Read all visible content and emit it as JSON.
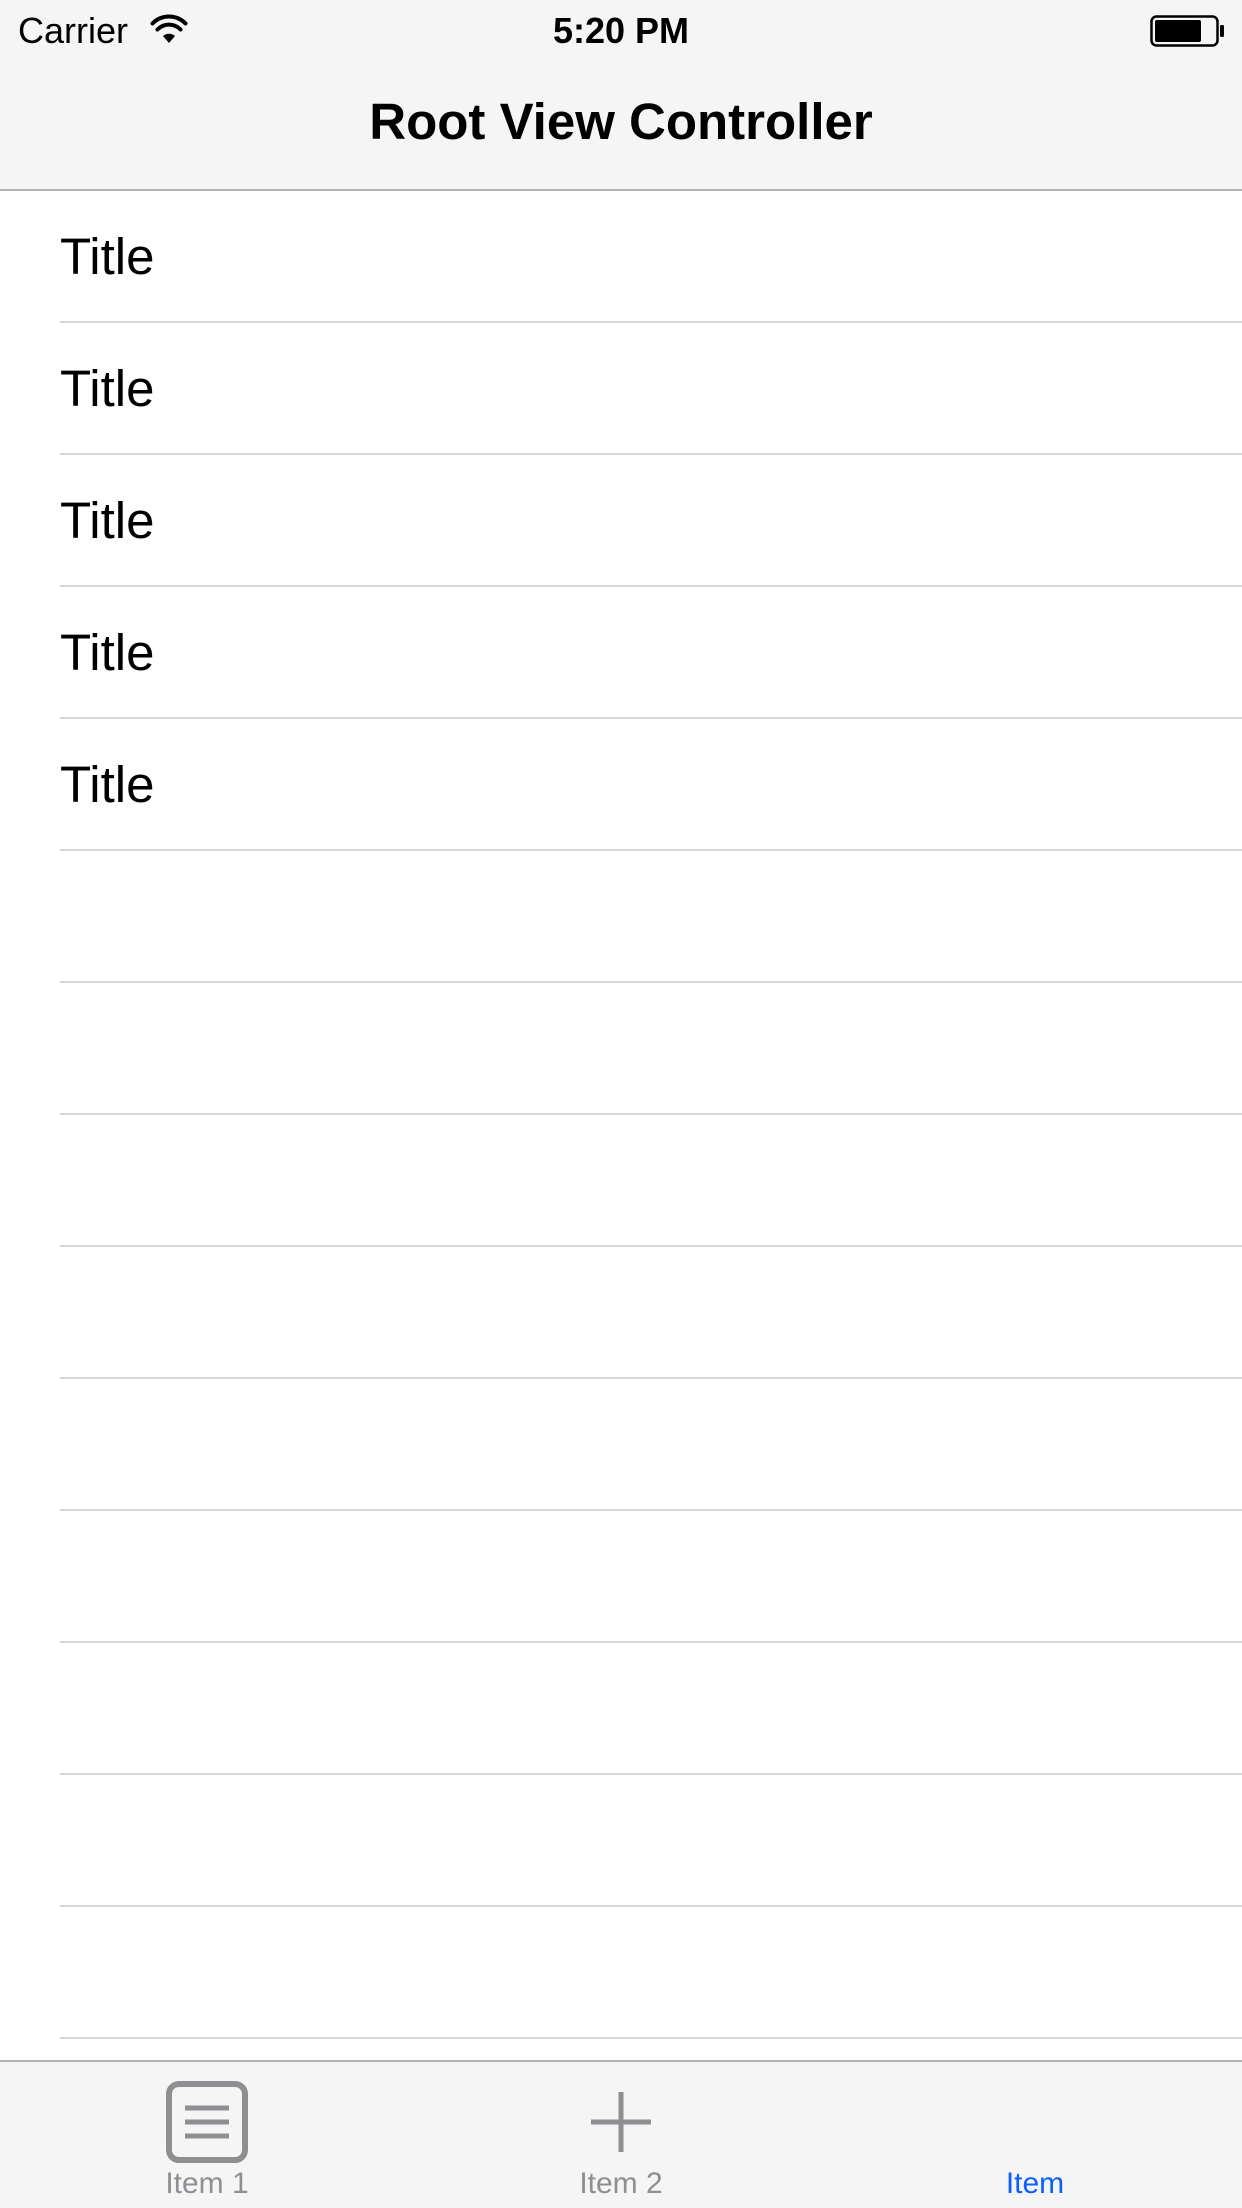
{
  "status_bar": {
    "carrier": "Carrier",
    "time": "5:20 PM"
  },
  "nav_bar": {
    "title": "Root View Controller"
  },
  "table": {
    "rows": [
      {
        "title": "Title"
      },
      {
        "title": "Title"
      },
      {
        "title": "Title"
      },
      {
        "title": "Title"
      },
      {
        "title": "Title"
      },
      {
        "title": ""
      },
      {
        "title": ""
      },
      {
        "title": ""
      },
      {
        "title": ""
      },
      {
        "title": ""
      },
      {
        "title": ""
      },
      {
        "title": ""
      },
      {
        "title": ""
      },
      {
        "title": ""
      },
      {
        "title": ""
      }
    ]
  },
  "tab_bar": {
    "tabs": [
      {
        "label": "Item 1",
        "icon": "list-icon",
        "selected": false
      },
      {
        "label": "Item 2",
        "icon": "plus-icon",
        "selected": false
      },
      {
        "label": "Item",
        "icon": "",
        "selected": true
      }
    ]
  },
  "colors": {
    "accent": "#0a60ff",
    "inactive": "#8e8e93",
    "bar_background": "#f5f5f5",
    "separator": "#d6d6d6"
  }
}
